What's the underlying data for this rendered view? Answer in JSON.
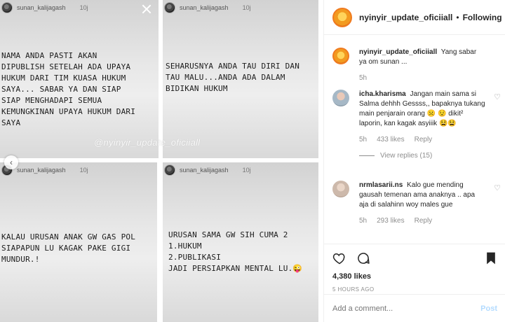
{
  "stories": [
    {
      "user": "sunan_kalijagash",
      "time": "10j",
      "text": "NAMA ANDA PASTI AKAN\nDIPUBLISH SETELAH ADA UPAYA\nHUKUM DARI TIM KUASA HUKUM\nSAYA... SABAR YA DAN SIAP\nSIAP MENGHADAPI SEMUA\nKEMUNGKINAN UPAYA HUKUM DARI\nSAYA"
    },
    {
      "user": "sunan_kalijagash",
      "time": "10j",
      "text": "SEHARUSNYA ANDA TAU DIRI DAN\nTAU MALU...ANDA ADA DALAM\nBIDIKAN HUKUM"
    },
    {
      "user": "sunan_kalijagash",
      "time": "10j",
      "text": "KALAU URUSAN ANAK GW GAS POL\nSIAPAPUN LU KAGAK PAKE GIGI\nMUNDUR.!"
    },
    {
      "user": "sunan_kalijagash",
      "time": "10j",
      "text": "URUSAN SAMA GW SIH CUMA 2\n1.HUKUM\n2.PUBLIKASI\nJADI PERSIAPKAN MENTAL LU.😜"
    }
  ],
  "watermark": "@nyinyir_update_oficiiall",
  "icons": {
    "close": "close-icon",
    "prev": "chevron-left-icon",
    "heart": "heart-icon",
    "comment": "comment-icon",
    "share": "share-icon",
    "bookmark": "bookmark-icon"
  },
  "header": {
    "username": "nyinyir_update_oficiiall",
    "separator": "•",
    "follow": "Following"
  },
  "caption": {
    "username": "nyinyir_update_oficiiall",
    "text": "Yang sabar ya om sunan ...",
    "time": "5h"
  },
  "comments": [
    {
      "username": "icha.kharisma",
      "text": "Jangan main sama si Salma dehhh Gessss,, bapaknya tukang main penjarain orang ☹️ 😟 dikit² laporin, kan kagak asyiiik 😫😫",
      "time": "5h",
      "likes": "433 likes",
      "reply": "Reply",
      "view_replies": "View replies (15)"
    },
    {
      "username": "nrmlasarii.ns",
      "text": "Kalo gue mending gausah temenan ama anaknya .. apa aja di salahinn woy males gue",
      "time": "5h",
      "likes": "293 likes",
      "reply": "Reply"
    }
  ],
  "post": {
    "likes": "4,380 likes",
    "time_ago": "5 HOURS AGO"
  },
  "composer": {
    "placeholder": "Add a comment...",
    "post_label": "Post"
  },
  "colors": {
    "accent_post": "#b3dbff",
    "avatar_ring": "#f07a20",
    "muted": "#8e8e8e"
  }
}
